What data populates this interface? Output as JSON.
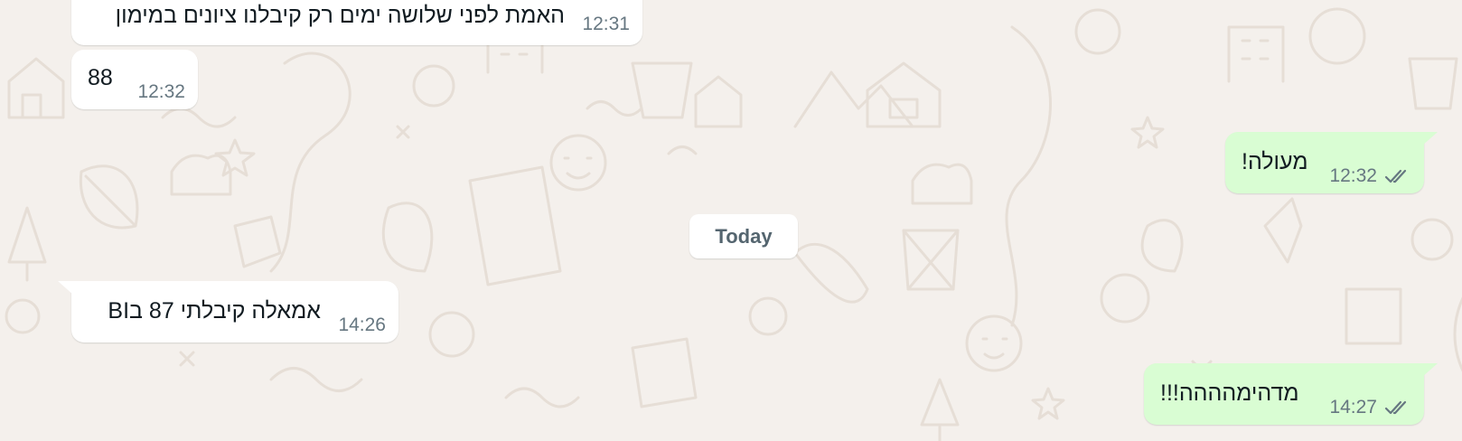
{
  "day_separator": "Today",
  "messages": [
    {
      "direction": "in",
      "text": "האמת לפני שלושה ימים רק קיבלנו ציונים במימון",
      "time": "12:31"
    },
    {
      "direction": "in",
      "text": "88",
      "time": "12:32"
    },
    {
      "direction": "out",
      "text": "מעולה!",
      "time": "12:32",
      "status": "read"
    },
    {
      "direction": "in",
      "text": "אמאלה קיבלתי 87 בBI",
      "time": "14:26"
    },
    {
      "direction": "out",
      "text": "מדהימהההה!!!",
      "time": "14:27",
      "status": "read"
    }
  ],
  "colors": {
    "background": "#f4f0ec",
    "incoming_bubble": "#ffffff",
    "outgoing_bubble": "#d9fdd3",
    "timestamp": "#667781",
    "read_ticks": "#667781",
    "doodle": "#e6ded6"
  },
  "icons": {
    "read_status": "double-check-icon"
  }
}
